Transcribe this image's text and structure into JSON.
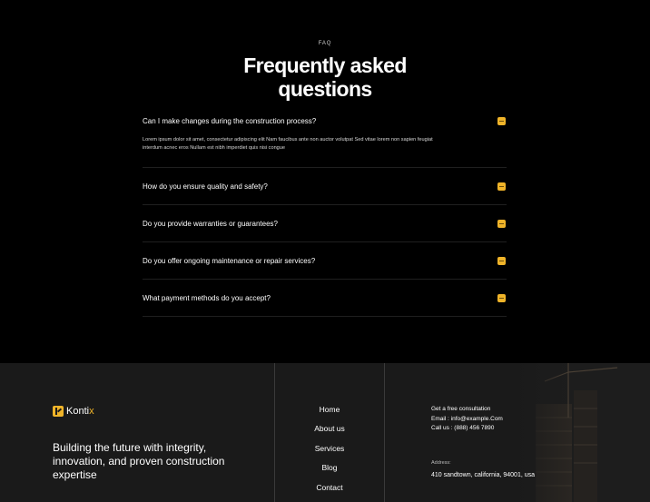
{
  "faq": {
    "eyebrow": "FAQ",
    "heading_line1": "Frequently asked",
    "heading_line2": "questions",
    "items": [
      {
        "question": "Can I make changes during the construction process?",
        "answer": "Lorem ipsum dolor sit amet, consectetur adipiscing elit Nam faucibus ante non auctor volutpat Sed vitae lorem non sapien feugiat interdum acnec eros Nullam est nibh imperdiet quis nisi congue",
        "expanded": true
      },
      {
        "question": "How do you ensure quality and safety?",
        "expanded": false
      },
      {
        "question": "Do you provide warranties or guarantees?",
        "expanded": false
      },
      {
        "question": "Do you offer ongoing maintenance or repair services?",
        "expanded": false
      },
      {
        "question": "What payment methods do you accept?",
        "expanded": false
      }
    ],
    "toggle_icon": "minus-icon",
    "accent_color": "#f0b429"
  },
  "footer": {
    "logo_text_main": "Konti",
    "logo_text_accent": "x",
    "logo_icon": "k-logo-icon",
    "tagline": "Building the future with integrity, innovation, and proven construction expertise",
    "nav": [
      "Home",
      "About us",
      "Services",
      "Blog",
      "Contact"
    ],
    "contact_heading": "Get a free consultation",
    "email": "Email : info@example.Com",
    "phone": "Call us : (888) 456 7890",
    "address_label": "Address:",
    "address": "410 sandtown, california, 94001, usa"
  }
}
